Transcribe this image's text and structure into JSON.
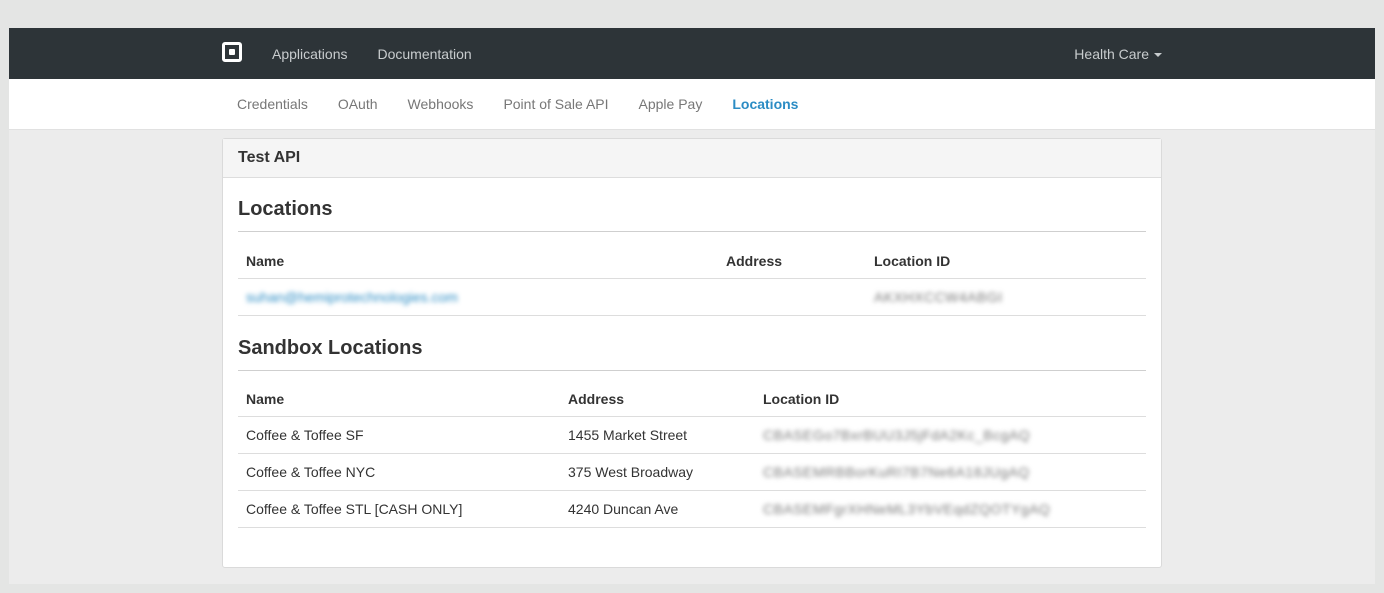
{
  "topbar": {
    "logo_icon": "square-logo-icon",
    "nav": [
      "Applications",
      "Documentation"
    ],
    "account": "Health Care"
  },
  "subnav": {
    "items": [
      "Credentials",
      "OAuth",
      "Webhooks",
      "Point of Sale API",
      "Apple Pay",
      "Locations"
    ],
    "active": "Locations"
  },
  "panel": {
    "title": "Test API",
    "locations": {
      "heading": "Locations",
      "columns": [
        "Name",
        "Address",
        "Location ID"
      ],
      "rows": [
        {
          "name": "suhan@hemiprotechnologies.com",
          "address": "",
          "location_id": "AKXHXCCW4ABGI"
        }
      ]
    },
    "sandbox": {
      "heading": "Sandbox Locations",
      "columns": [
        "Name",
        "Address",
        "Location ID"
      ],
      "rows": [
        {
          "name": "Coffee & Toffee SF",
          "address": "1455 Market Street",
          "location_id": "CBASEGo7BxrBUU3J5jFdA2Kc_BcgAQ"
        },
        {
          "name": "Coffee & Toffee NYC",
          "address": "375 West Broadway",
          "location_id": "CBASEMRBBorKuRI7B7Ne6A18JUgAQ"
        },
        {
          "name": "Coffee & Toffee STL [CASH ONLY]",
          "address": "4240 Duncan Ave",
          "location_id": "CBASEMFgrXHNeML3YbVEqdZQOTYgAQ"
        }
      ]
    }
  },
  "colors": {
    "topbar": "#2d3438",
    "accent": "#2b8cc4"
  }
}
